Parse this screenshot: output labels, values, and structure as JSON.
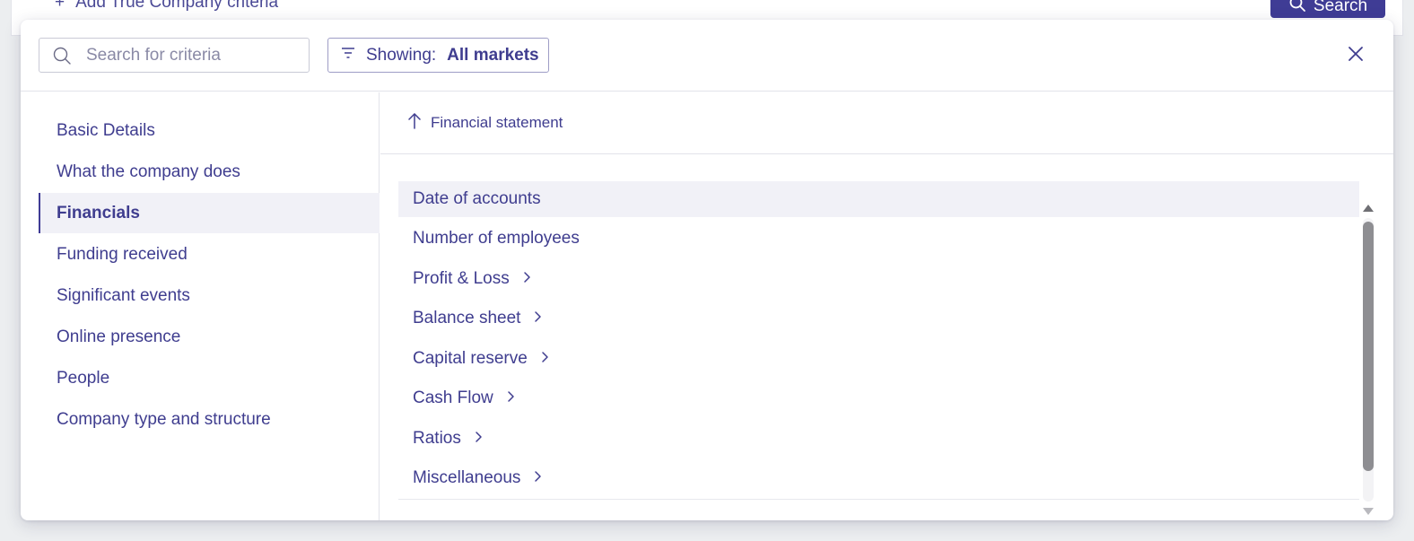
{
  "background": {
    "add_criteria_label": "Add True Company criteria",
    "search_button_label": "Search"
  },
  "header": {
    "search_placeholder": "Search for criteria",
    "filter_prefix": "Showing:",
    "filter_value": "All markets"
  },
  "sidebar": {
    "active_index": 2,
    "items": [
      {
        "label": "Basic Details"
      },
      {
        "label": "What the company does"
      },
      {
        "label": "Financials"
      },
      {
        "label": "Funding received"
      },
      {
        "label": "Significant events"
      },
      {
        "label": "Online presence"
      },
      {
        "label": "People"
      },
      {
        "label": "Company type and structure"
      }
    ]
  },
  "main": {
    "breadcrumb": "Financial statement",
    "items": [
      {
        "label": "Date of accounts",
        "has_children": false
      },
      {
        "label": "Number of employees",
        "has_children": false
      },
      {
        "label": "Profit & Loss",
        "has_children": true
      },
      {
        "label": "Balance sheet",
        "has_children": true
      },
      {
        "label": "Capital reserve",
        "has_children": true
      },
      {
        "label": "Cash Flow",
        "has_children": true
      },
      {
        "label": "Ratios",
        "has_children": true
      },
      {
        "label": "Miscellaneous",
        "has_children": true
      }
    ]
  },
  "colors": {
    "accent": "#3f3c95",
    "text": "#3f3d8f",
    "hover_bg": "#f1f1f7"
  }
}
